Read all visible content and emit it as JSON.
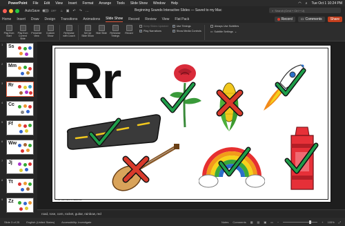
{
  "menubar": {
    "app": "PowerPoint",
    "items": [
      "File",
      "Edit",
      "View",
      "Insert",
      "Format",
      "Arrange",
      "Tools",
      "Slide Show",
      "Window",
      "Help"
    ],
    "clock": "Tue Oct 1 10:24 PM"
  },
  "titlebar": {
    "autosave": "AutoSave",
    "autosave_state": "OFF",
    "document_title": "Beginning Sounds Interactive Slides — Saved to my Mac",
    "search_placeholder": "Search (Cmd + Ctrl + U)"
  },
  "tabs": {
    "items": [
      "Home",
      "Insert",
      "Draw",
      "Design",
      "Transitions",
      "Animations",
      "Slide Show",
      "Record",
      "Review",
      "View",
      "Flat Pack"
    ],
    "active": "Slide Show",
    "record_label": "Record",
    "comments_label": "Comments",
    "share_label": "Share"
  },
  "ribbon": {
    "buttons": [
      "Play from Start",
      "Play from Current Slide",
      "Presenter View",
      "Custom Show",
      "Rehearse with Coach",
      "Set Up Slide Show",
      "Hide Slide",
      "Rehearse Timings",
      "Record"
    ],
    "checks": {
      "keep_slides_updated": "Keep Slides Updated",
      "play_narrations": "Play Narrations",
      "use_timings": "Use Timings",
      "show_media_controls": "Show Media Controls",
      "always_use_subtitles": "Always Use Subtitles",
      "subtitle_settings": "Subtitle Settings"
    }
  },
  "thumbnails": [
    {
      "num": "1",
      "letter": "Ss"
    },
    {
      "num": "2",
      "letter": "Mm"
    },
    {
      "num": "3",
      "letter": "Rr"
    },
    {
      "num": "4",
      "letter": "Cc"
    },
    {
      "num": "5",
      "letter": "Ff"
    },
    {
      "num": "6",
      "letter": "Ww"
    },
    {
      "num": "7",
      "letter": "Jj"
    },
    {
      "num": "8",
      "letter": "Tt"
    },
    {
      "num": "9",
      "letter": "Zz"
    }
  ],
  "slide": {
    "letter": "Rr",
    "credit": "© Ms. Bernhardt's Classroom",
    "items": [
      {
        "name": "rose",
        "mark": "check"
      },
      {
        "name": "corn",
        "mark": "x"
      },
      {
        "name": "rocket",
        "mark": "check"
      },
      {
        "name": "road",
        "mark": "check"
      },
      {
        "name": "guitar",
        "mark": "x"
      },
      {
        "name": "rainbow",
        "mark": "check"
      },
      {
        "name": "red crayon",
        "mark": "check"
      }
    ]
  },
  "notes": {
    "text": "road, rose, corn, rocket, guitar, rainbow, red"
  },
  "status": {
    "slide_info": "Slide 3 of 25",
    "language": "English (United States)",
    "accessibility": "Accessibility: Investigate",
    "notes": "Notes",
    "comments": "Comments",
    "zoom": "105%"
  },
  "colors": {
    "check": "#1f9e4a",
    "x": "#d93a2b",
    "accent": "#e05a3c"
  }
}
